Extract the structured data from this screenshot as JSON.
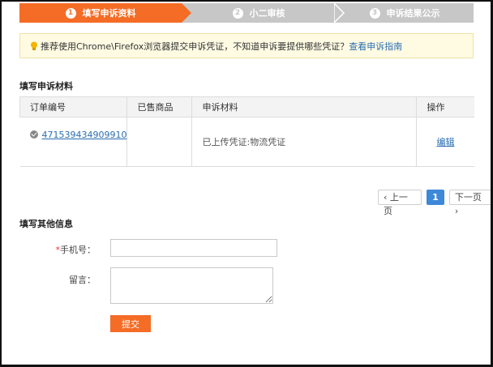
{
  "steps": [
    {
      "num": "1",
      "label": "填写申诉资料",
      "active": true
    },
    {
      "num": "2",
      "label": "小二审核",
      "active": false
    },
    {
      "num": "3",
      "label": "申诉结果公示",
      "active": false
    }
  ],
  "notice": {
    "text": "推荐使用Chrome\\Firefox浏览器提交申诉凭证，不知道申诉要提供哪些凭证？",
    "link": "查看申诉指南"
  },
  "materials_section": {
    "title": "填写申诉材料",
    "columns": [
      "订单编号",
      "已售商品",
      "申诉材料",
      "操作"
    ],
    "rows": [
      {
        "order_id": "471539434909910",
        "product": "",
        "material": "已上传凭证:物流凭证",
        "action": "编辑"
      }
    ]
  },
  "pagination": {
    "prev": "上一页",
    "current": "1",
    "next": "下一页"
  },
  "other_section": {
    "title": "填写其他信息",
    "phone_label": "手机号：",
    "phone_required_mark": "*",
    "phone_value": "",
    "message_label": "留言：",
    "message_value": "",
    "submit_label": "提交"
  },
  "colors": {
    "accent": "#f46c25",
    "link": "#2a6db1",
    "inactive_step": "#c7c7c7",
    "page_active": "#3e88d8"
  }
}
